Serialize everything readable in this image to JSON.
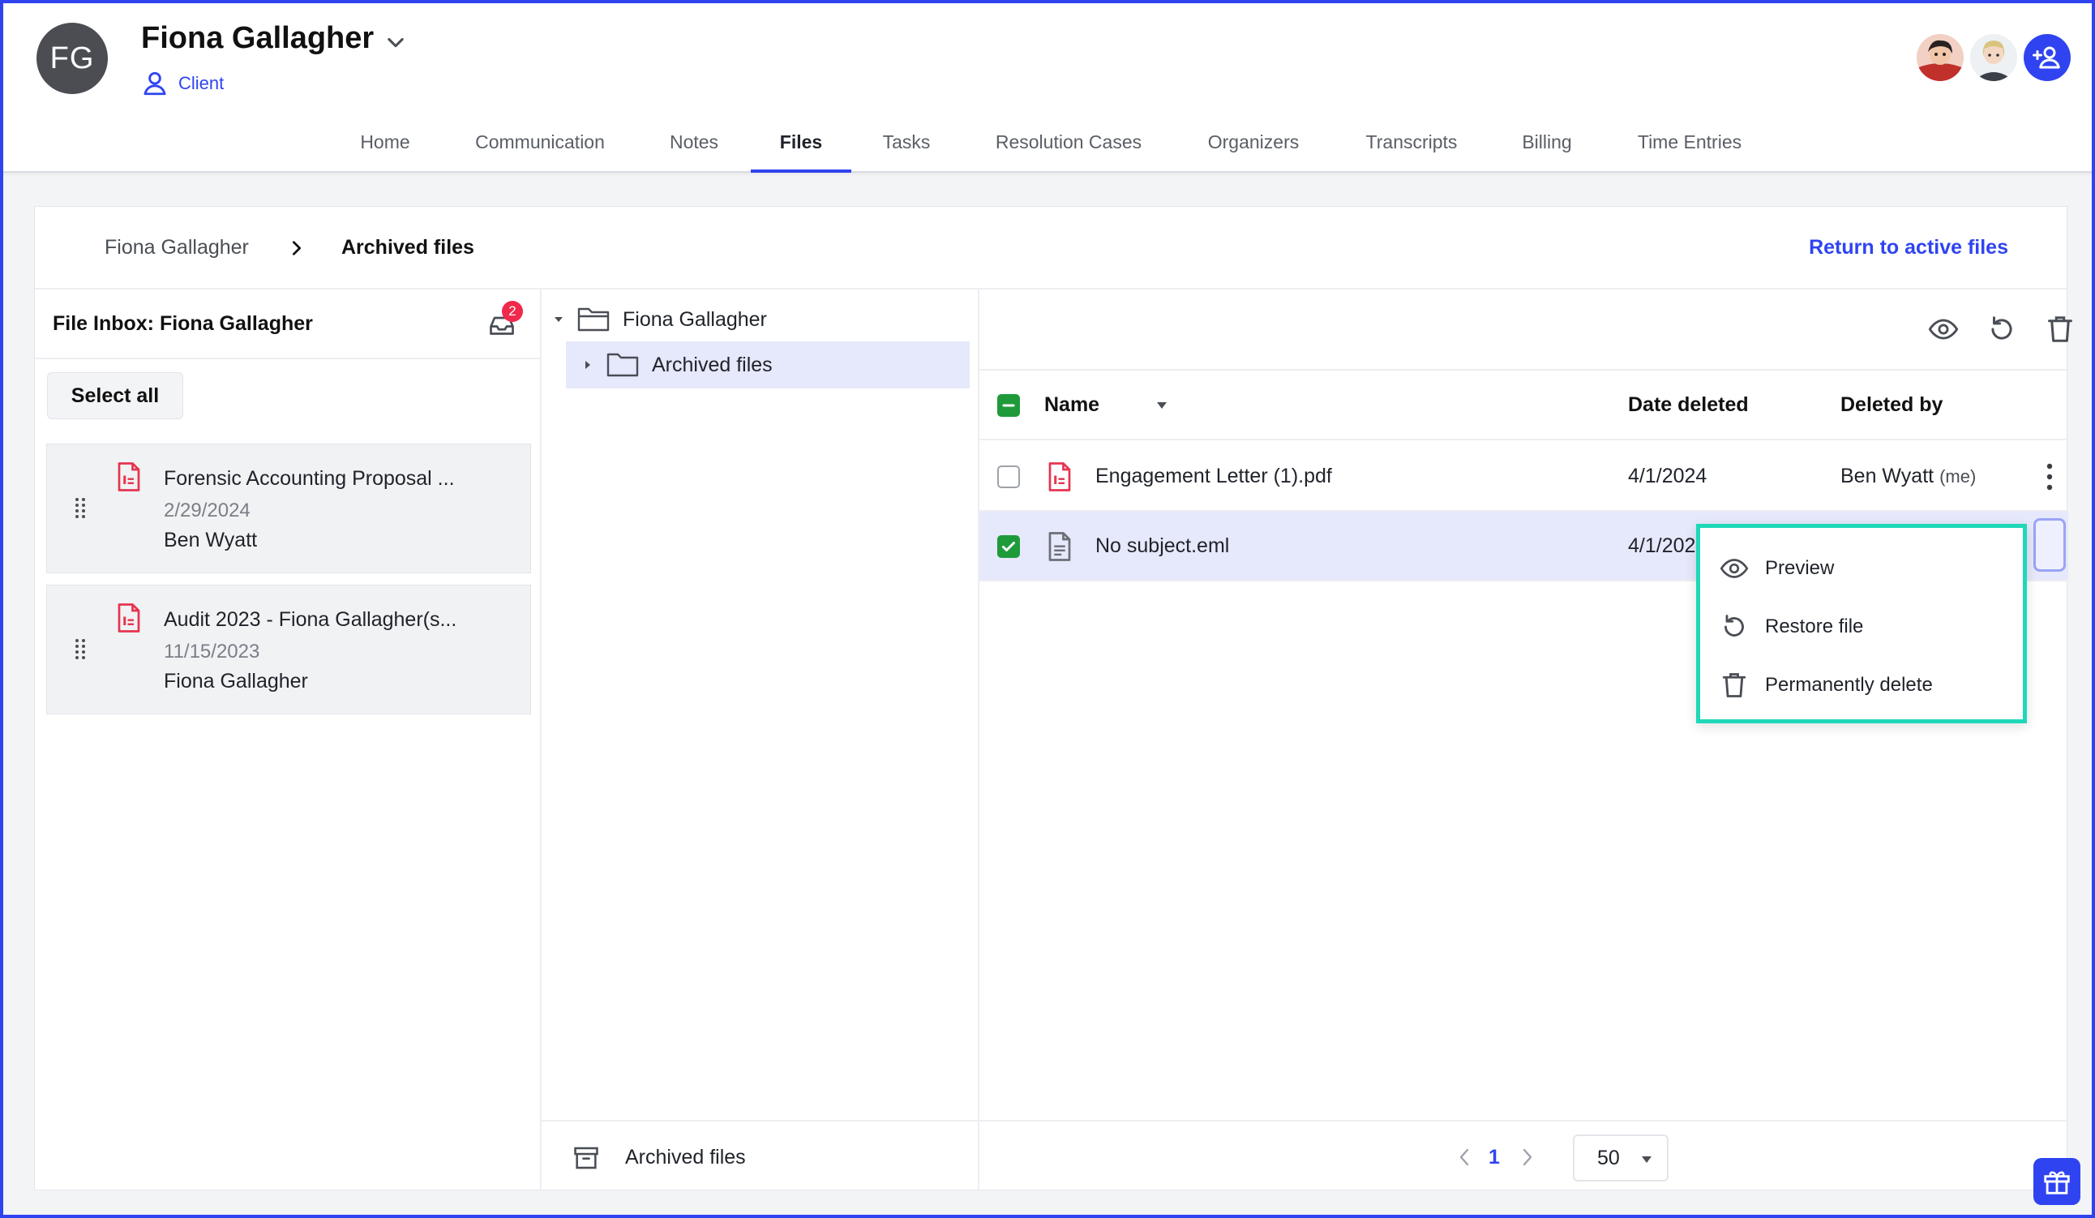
{
  "client": {
    "initials": "FG",
    "name": "Fiona Gallagher",
    "type": "Client"
  },
  "tabs": [
    {
      "label": "Home"
    },
    {
      "label": "Communication"
    },
    {
      "label": "Notes"
    },
    {
      "label": "Files",
      "active": true
    },
    {
      "label": "Tasks"
    },
    {
      "label": "Resolution Cases"
    },
    {
      "label": "Organizers"
    },
    {
      "label": "Transcripts"
    },
    {
      "label": "Billing"
    },
    {
      "label": "Time Entries"
    }
  ],
  "breadcrumb": {
    "parent": "Fiona Gallagher",
    "current": "Archived files",
    "return_link": "Return to active files"
  },
  "inbox": {
    "title": "File Inbox: Fiona Gallagher",
    "badge_count": "2",
    "select_all": "Select all",
    "items": [
      {
        "title": "Forensic Accounting Proposal ...",
        "date": "2/29/2024",
        "user": "Ben Wyatt"
      },
      {
        "title": "Audit 2023 - Fiona Gallagher(s...",
        "date": "11/15/2023",
        "user": "Fiona Gallagher"
      }
    ]
  },
  "tree": {
    "root": "Fiona Gallagher",
    "child": "Archived files",
    "footer": "Archived files"
  },
  "list": {
    "columns": {
      "name": "Name",
      "date": "Date deleted",
      "user": "Deleted by"
    },
    "rows": [
      {
        "name": "Engagement Letter (1).pdf",
        "date": "4/1/2024",
        "user": "Ben Wyatt",
        "user_suffix": "(me)",
        "icon": "pdf-file-icon",
        "checked": false
      },
      {
        "name": "No subject.eml",
        "date": "4/1/2024",
        "user": "",
        "icon": "email-file-icon",
        "checked": true
      }
    ],
    "page": "1",
    "per_page": "50"
  },
  "context_menu": {
    "items": [
      {
        "label": "Preview",
        "icon": "eye-icon"
      },
      {
        "label": "Restore file",
        "icon": "restore-icon"
      },
      {
        "label": "Permanently delete",
        "icon": "trash-icon"
      }
    ]
  },
  "colors": {
    "accent": "#2f44f0",
    "checkbox_green": "#1f9a3a",
    "menu_highlight": "#1fd8b8",
    "badge": "#f0294c",
    "pdf_red": "#e5354f"
  }
}
